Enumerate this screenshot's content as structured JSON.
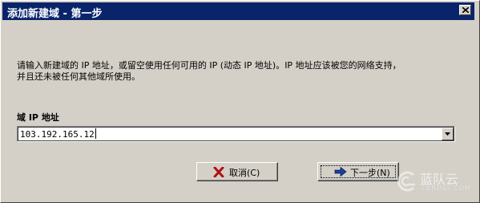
{
  "window": {
    "title": "添加新建域 - 第一步"
  },
  "description": {
    "line1": "请输入新建域的 IP 地址，或留空使用任何可用的 IP (动态 IP 地址)。IP 地址应该被您的网络支持，",
    "line2": "并且还未被任何其他域所使用。"
  },
  "ip_field": {
    "label": "域 IP 地址",
    "value": "103.192.165.12"
  },
  "buttons": {
    "cancel": "取消(C)",
    "next": "下一步(N)"
  },
  "watermark": {
    "text": "蓝队云",
    "sub": "LANDUI.COM"
  },
  "colors": {
    "titlebar": "#0a246a",
    "face": "#d4d0c8",
    "cancel_icon": "#b01010",
    "next_icon": "#1a3fa0"
  },
  "icons": {
    "close": "close-icon",
    "dropdown": "chevron-down-icon",
    "cancel": "red-x-icon",
    "next": "blue-arrow-right-icon"
  }
}
